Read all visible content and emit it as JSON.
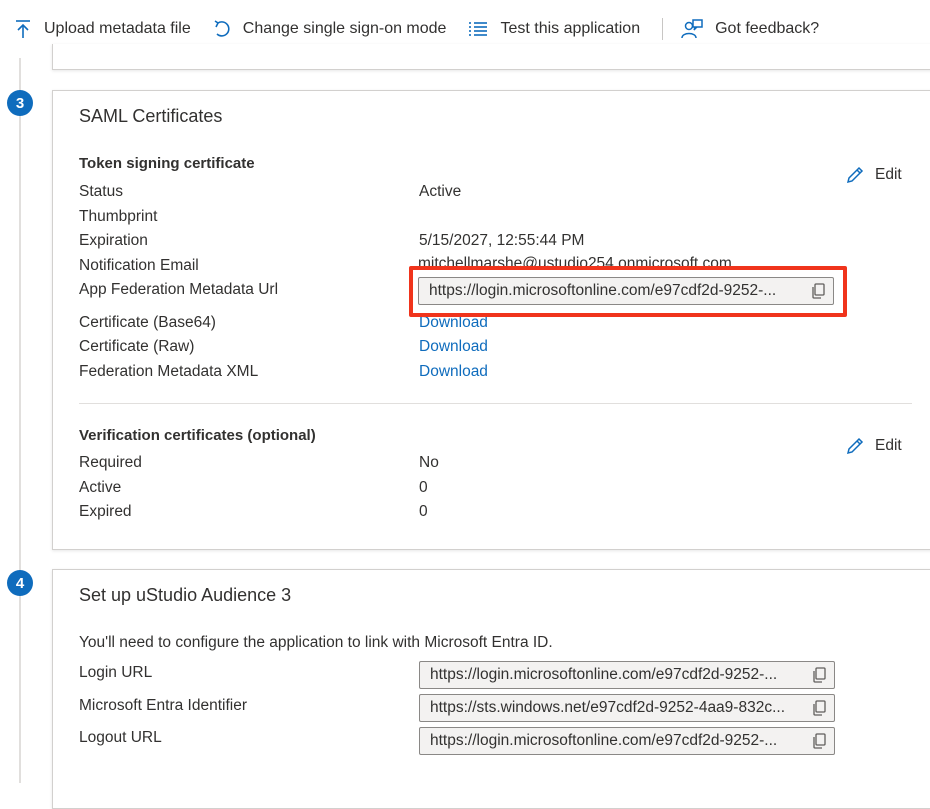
{
  "toolbar": {
    "upload_label": "Upload metadata file",
    "change_sso_label": "Change single sign-on mode",
    "test_label": "Test this application",
    "feedback_label": "Got feedback?"
  },
  "steps": {
    "step3": "3",
    "step4": "4"
  },
  "saml": {
    "title": "SAML Certificates",
    "token_section": "Token signing certificate",
    "edit_label": "Edit",
    "rows": {
      "status_label": "Status",
      "status_value": "Active",
      "thumbprint_label": "Thumbprint",
      "expiration_label": "Expiration",
      "expiration_value": "5/15/2027, 12:55:44 PM",
      "email_label": "Notification Email",
      "email_value": "mitchellmarshe@ustudio254.onmicrosoft.com",
      "metadata_url_label": "App Federation Metadata Url",
      "metadata_url_value": "https://login.microsoftonline.com/e97cdf2d-9252-...",
      "cert_base64_label": "Certificate (Base64)",
      "cert_raw_label": "Certificate (Raw)",
      "fed_xml_label": "Federation Metadata XML",
      "download_label": "Download"
    },
    "verification_section": "Verification certificates (optional)",
    "verification": {
      "required_label": "Required",
      "required_value": "No",
      "active_label": "Active",
      "active_value": "0",
      "expired_label": "Expired",
      "expired_value": "0"
    }
  },
  "setup": {
    "title": "Set up uStudio Audience 3",
    "description": "You'll need to configure the application to link with Microsoft Entra ID.",
    "login_url_label": "Login URL",
    "login_url_value": "https://login.microsoftonline.com/e97cdf2d-9252-...",
    "entra_id_label": "Microsoft Entra Identifier",
    "entra_id_value": "https://sts.windows.net/e97cdf2d-9252-4aa9-832c...",
    "logout_url_label": "Logout URL",
    "logout_url_value": "https://login.microsoftonline.com/e97cdf2d-9252-..."
  },
  "colors": {
    "accent": "#0f6cbd",
    "highlight": "#f0341c"
  }
}
